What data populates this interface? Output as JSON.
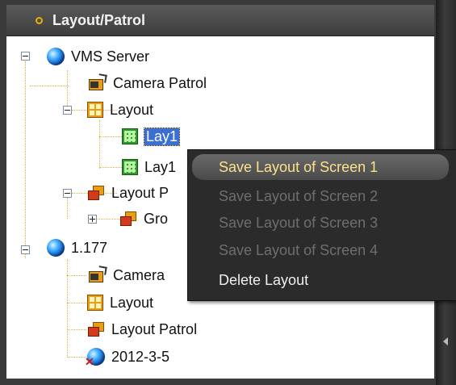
{
  "panel": {
    "title": "Layout/Patrol"
  },
  "tree": {
    "server1": "VMS Server",
    "camera_patrol": "Camera Patrol",
    "layout": "Layout",
    "lay1": "Lay1",
    "lay2": "Lay1",
    "layout_patrol": "Layout P",
    "group": "Gro",
    "server2": "1.177",
    "camera2": "Camera",
    "layout2": "Layout",
    "layout_patrol2": "Layout Patrol",
    "device": "2012-3-5"
  },
  "context_menu": {
    "items": [
      {
        "label": "Save Layout of Screen 1",
        "state": "highlighted"
      },
      {
        "label": "Save Layout of Screen 2",
        "state": "disabled"
      },
      {
        "label": "Save Layout of Screen 3",
        "state": "disabled"
      },
      {
        "label": "Save Layout of Screen 4",
        "state": "disabled"
      },
      {
        "label": "Delete Layout",
        "state": "enabled"
      }
    ]
  },
  "icons": {
    "server": "globe-icon",
    "camera_patrol": "camera-patrol-icon",
    "layout": "layout-grid-icon",
    "lay": "layout-green-grid-icon",
    "layout_patrol": "layout-patrol-icon",
    "device": "globe-disconnected-icon"
  },
  "colors": {
    "accent": "#e8b400",
    "selection": "#3a6fd3",
    "menu_bg": "#2b2b2b",
    "tree_lines": "#e0b23a"
  }
}
